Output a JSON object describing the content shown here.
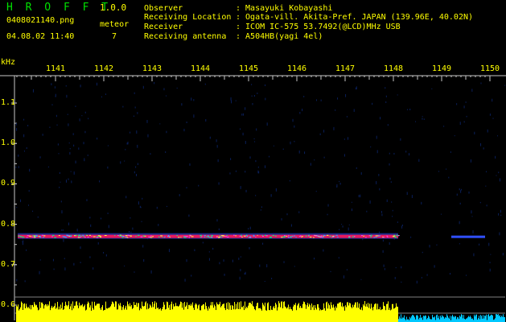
{
  "header": {
    "app_title": "H R O F F T",
    "version": "1.0.0",
    "filename": "0408021140.png",
    "datetime": "04.08.02 11:40",
    "meteor_label": "meteor",
    "meteor_count": "7"
  },
  "info": [
    {
      "label": "Observer",
      "value": ": Masayuki Kobayashi"
    },
    {
      "label": "Receiving Location",
      "value": ": Ogata-vill. Akita-Pref. JAPAN (139.96E, 40.02N)"
    },
    {
      "label": "Receiver",
      "value": ": ICOM IC-575 53.7492(@LCD)MHz USB"
    },
    {
      "label": "Receiving antenna",
      "value": ": A504HB(yagi 4el)"
    }
  ],
  "colors": {
    "background": "#000000",
    "text": "#ffff00",
    "title": "#00e000",
    "axis": "#c8c8c8",
    "signal": "#e6195f",
    "noise": "#ffff00",
    "noise_low": "#00c8ff"
  },
  "chart_data": {
    "type": "heatmap",
    "ylabel": "kHz",
    "x_ticks": [
      "1141",
      "1142",
      "1143",
      "1144",
      "1145",
      "1146",
      "1147",
      "1148",
      "1149",
      "1150"
    ],
    "y_ticks": [
      "1.1",
      "1.0",
      "0.9",
      "0.8",
      "0.7",
      "0.6"
    ],
    "ylim": [
      0.6,
      1.15
    ],
    "signal_band_khz": 0.77,
    "signal_segments": [
      {
        "x_start": 1140.8,
        "x_end": 1148.1
      },
      {
        "x_start": 1149.2,
        "x_end": 1149.9
      }
    ]
  }
}
